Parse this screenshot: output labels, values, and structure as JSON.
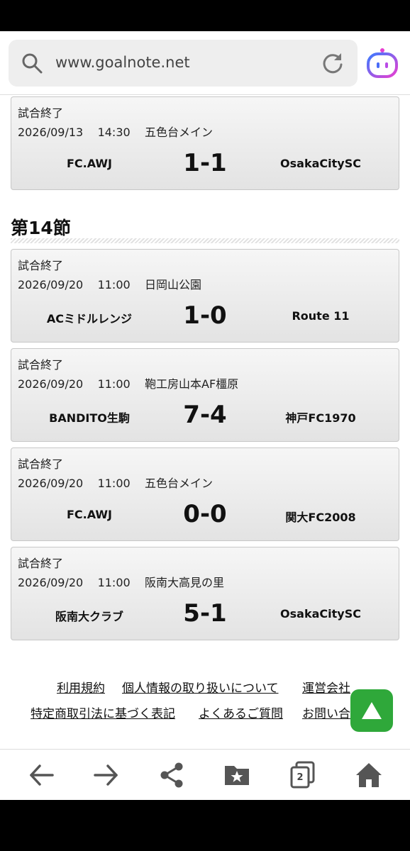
{
  "browser": {
    "url": "www.goalnote.net",
    "icons": [
      "search-icon",
      "reload-icon",
      "assistant-icon"
    ]
  },
  "top_match": {
    "status": "試合終了",
    "date": "2026/09/13",
    "time": "14:30",
    "venue": "五色台メイン",
    "home": "FC.AWJ",
    "score": "1-1",
    "away": "OsakaCitySC"
  },
  "round": {
    "title": "第14節",
    "matches": [
      {
        "status": "試合終了",
        "date": "2026/09/20",
        "time": "11:00",
        "venue": "日岡山公園",
        "home": "ACミドルレンジ",
        "score": "1-0",
        "away": "Route 11"
      },
      {
        "status": "試合終了",
        "date": "2026/09/20",
        "time": "11:00",
        "venue": "鞄工房山本AF橿原",
        "home": "BANDITO生駒",
        "score": "7-4",
        "away": "神戸FC1970"
      },
      {
        "status": "試合終了",
        "date": "2026/09/20",
        "time": "11:00",
        "venue": "五色台メイン",
        "home": "FC.AWJ",
        "score": "0-0",
        "away": "関大FC2008"
      },
      {
        "status": "試合終了",
        "date": "2026/09/20",
        "time": "11:00",
        "venue": "阪南大高見の里",
        "home": "阪南大クラブ",
        "score": "5-1",
        "away": "OsakaCitySC"
      }
    ]
  },
  "footer": {
    "links": [
      "利用規約",
      "個人情報の取り扱いについて",
      "運営会社",
      "特定商取引法に基づく表記",
      "よくあるご質問",
      "お問い合わせ"
    ]
  },
  "nav": {
    "tab_count": "2",
    "icons": [
      "back-arrow-icon",
      "forward-arrow-icon",
      "share-icon",
      "bookmarks-icon",
      "tabs-icon",
      "home-icon"
    ]
  },
  "colors": {
    "accent_green": "#2fa83a",
    "assistant_gradient_start": "#3b7bff",
    "assistant_gradient_end": "#e83fd1"
  }
}
